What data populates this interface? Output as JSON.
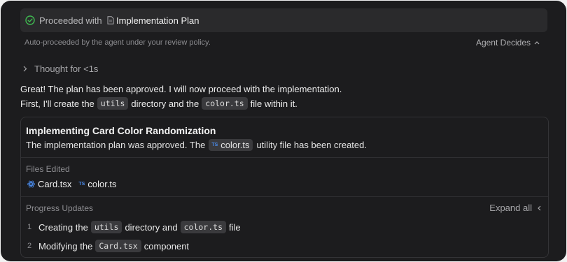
{
  "proceeded": {
    "label": "Proceeded with",
    "plan_name": "Implementation Plan"
  },
  "policy": {
    "text": "Auto-proceeded by the agent under your review policy.",
    "mode": "Agent Decides"
  },
  "thought": {
    "label": "Thought for <1s"
  },
  "message": {
    "line1": "Great! The plan has been approved. I will now proceed with the implementation.",
    "line2_a": "First, I'll create the",
    "line2_code1": "utils",
    "line2_b": "directory and the",
    "line2_code2": "color.ts",
    "line2_c": "file within it."
  },
  "card": {
    "title": "Implementing Card Color Randomization",
    "desc_a": "The implementation plan was approved. The",
    "desc_ts": "TS",
    "desc_file": "color.ts",
    "desc_b": "utility file has been created.",
    "files_label": "Files Edited",
    "files": [
      {
        "name": "Card.tsx",
        "icon": "react-icon"
      },
      {
        "name": "color.ts",
        "icon": "ts-icon",
        "badge": "TS"
      }
    ],
    "progress_label": "Progress Updates",
    "expand_label": "Expand all",
    "progress": [
      {
        "num": "1",
        "a": "Creating the",
        "code1": "utils",
        "b": "directory and",
        "code2": "color.ts",
        "c": "file"
      },
      {
        "num": "2",
        "a": "Modifying the",
        "code1": "Card.tsx",
        "b": "component"
      }
    ]
  },
  "colors": {
    "background": "#1c1c1e",
    "bar": "#2a2a2c",
    "check": "#3fb950",
    "ts_blue": "#4a8df0"
  }
}
